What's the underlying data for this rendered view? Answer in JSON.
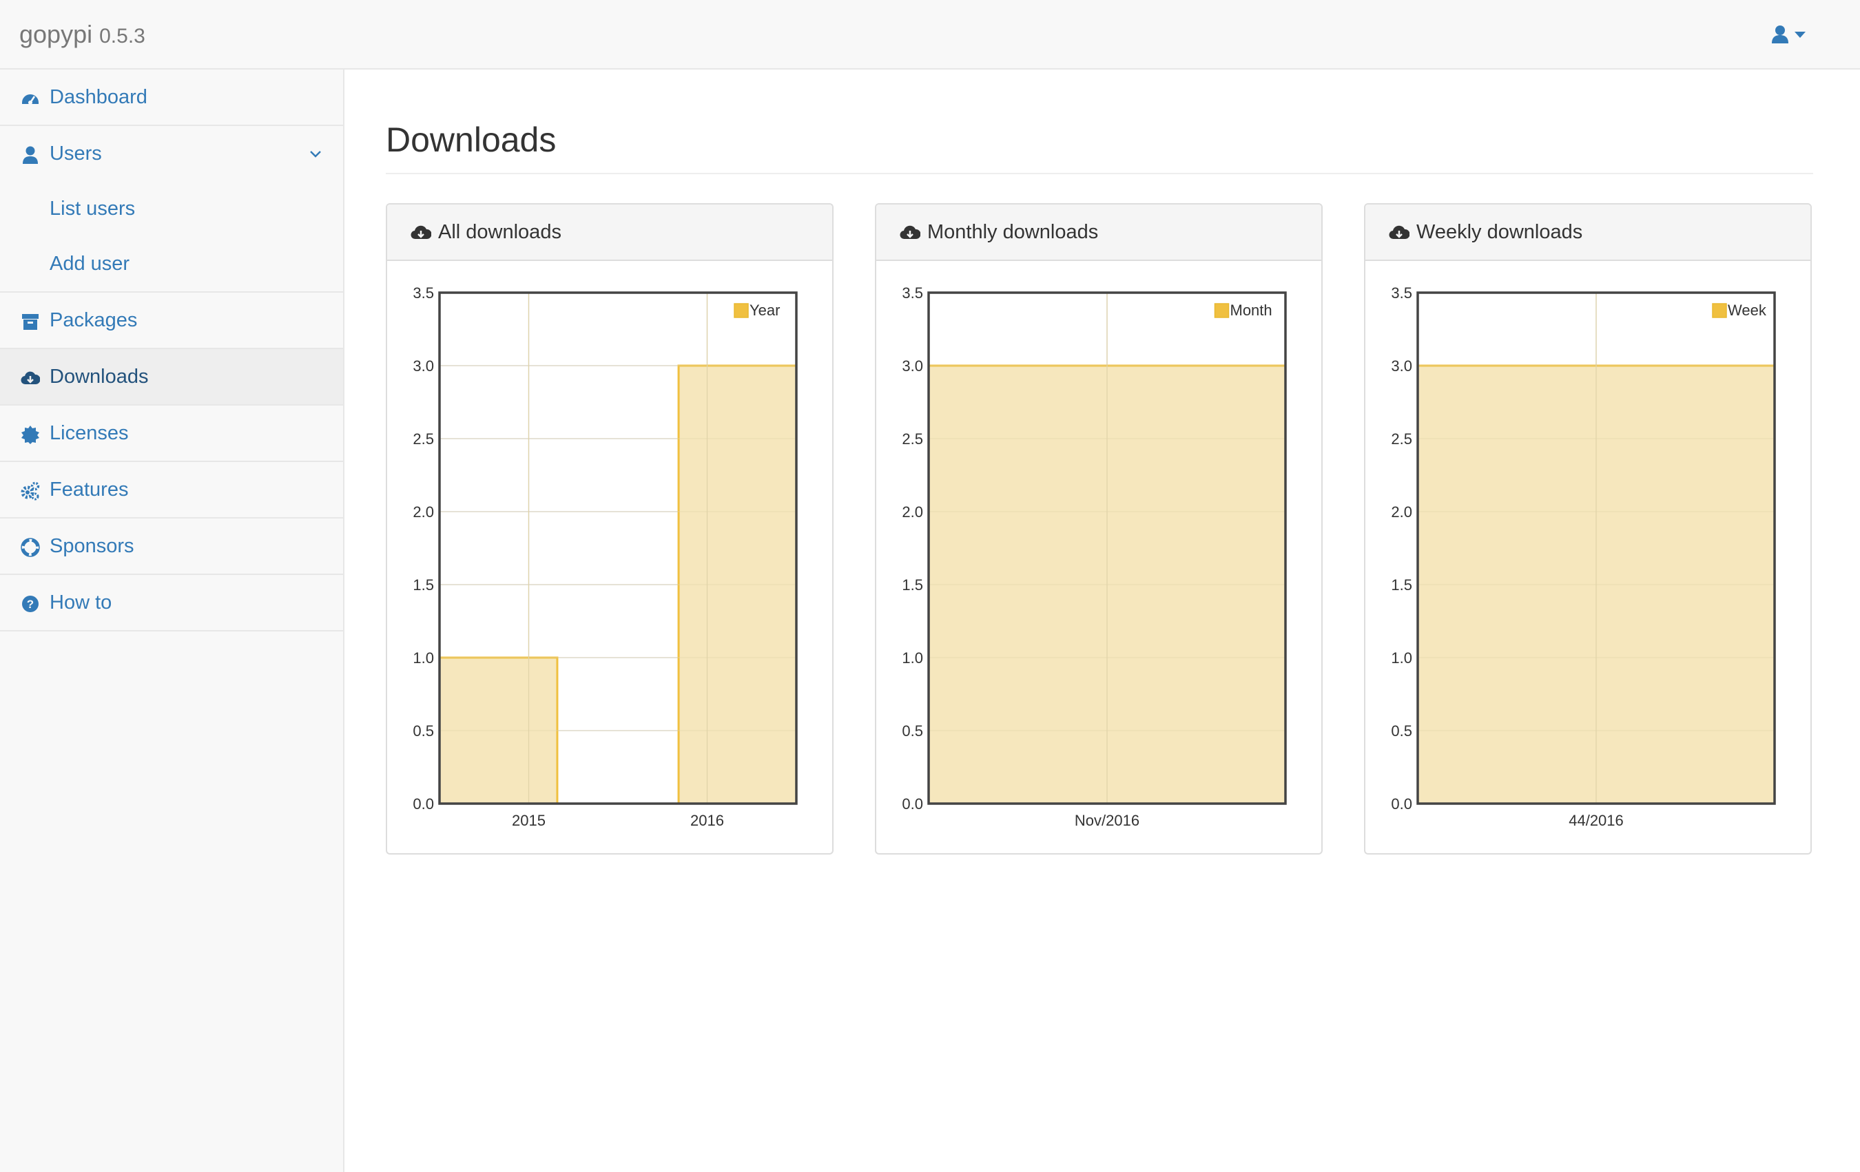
{
  "app": {
    "name": "gopypi",
    "version": "0.5.3"
  },
  "user_menu": {
    "icon": "user-icon",
    "caret": "caret-down-icon"
  },
  "sidebar": {
    "items": [
      {
        "key": "dashboard",
        "label": "Dashboard",
        "icon": "dashboard-icon"
      },
      {
        "key": "users",
        "label": "Users",
        "icon": "user-icon",
        "expanded": true
      },
      {
        "key": "list-users",
        "label": "List users",
        "sub": true
      },
      {
        "key": "add-user",
        "label": "Add user",
        "sub": true
      },
      {
        "key": "packages",
        "label": "Packages",
        "icon": "archive-icon"
      },
      {
        "key": "downloads",
        "label": "Downloads",
        "icon": "cloud-download-icon",
        "active": true
      },
      {
        "key": "licenses",
        "label": "Licenses",
        "icon": "certificate-icon"
      },
      {
        "key": "features",
        "label": "Features",
        "icon": "cogs-icon"
      },
      {
        "key": "sponsors",
        "label": "Sponsors",
        "icon": "life-ring-icon"
      },
      {
        "key": "howto",
        "label": "How to",
        "icon": "question-circle-icon"
      }
    ]
  },
  "page": {
    "title": "Downloads"
  },
  "colors": {
    "bar_fill": "#f5e6b9",
    "bar_stroke": "#f0c040",
    "link": "#337ab7",
    "legend_swatch": "#f0c040"
  },
  "panels": [
    {
      "title": "All downloads",
      "icon": "cloud-download-icon"
    },
    {
      "title": "Monthly downloads",
      "icon": "cloud-download-icon"
    },
    {
      "title": "Weekly downloads",
      "icon": "cloud-download-icon"
    }
  ],
  "chart_data": [
    {
      "type": "bar",
      "categories": [
        "2015",
        "2016"
      ],
      "series": [
        {
          "name": "Year",
          "values": [
            1,
            3
          ]
        }
      ],
      "ylim": [
        0,
        3.5
      ],
      "yticks": [
        "0.0",
        "0.5",
        "1.0",
        "1.5",
        "2.0",
        "2.5",
        "3.0",
        "3.5"
      ],
      "grid": true,
      "legend": "top-right"
    },
    {
      "type": "bar",
      "categories": [
        "Nov/2016"
      ],
      "series": [
        {
          "name": "Month",
          "values": [
            3
          ]
        }
      ],
      "ylim": [
        0,
        3.5
      ],
      "yticks": [
        "0.0",
        "0.5",
        "1.0",
        "1.5",
        "2.0",
        "2.5",
        "3.0",
        "3.5"
      ],
      "grid": true,
      "legend": "top-right"
    },
    {
      "type": "bar",
      "categories": [
        "44/2016"
      ],
      "series": [
        {
          "name": "Week",
          "values": [
            3
          ]
        }
      ],
      "ylim": [
        0,
        3.5
      ],
      "yticks": [
        "0.0",
        "0.5",
        "1.0",
        "1.5",
        "2.0",
        "2.5",
        "3.0",
        "3.5"
      ],
      "grid": true,
      "legend": "top-right"
    }
  ]
}
